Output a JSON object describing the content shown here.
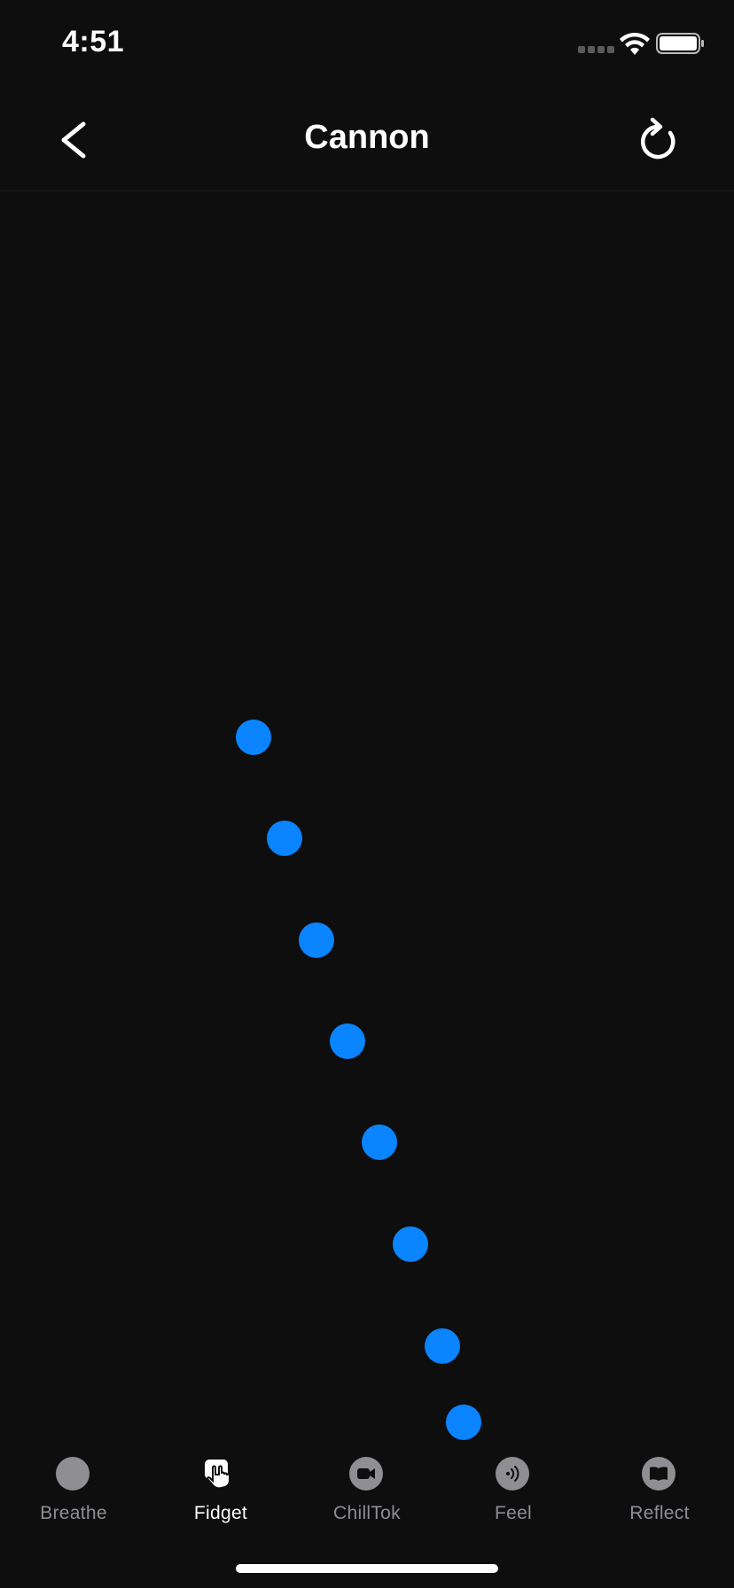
{
  "status_bar": {
    "time": "4:51"
  },
  "header": {
    "title": "Cannon",
    "back_icon": "chevron-left-icon",
    "reload_icon": "reload-icon"
  },
  "colors": {
    "background": "#0e0e0f",
    "ball": "#0a84ff",
    "tab_inactive": "#8e8e93",
    "tab_active": "#ffffff"
  },
  "tabs": [
    {
      "label": "Breathe",
      "icon": "circle-icon",
      "active": false
    },
    {
      "label": "Fidget",
      "icon": "hand-tap-icon",
      "active": true
    },
    {
      "label": "ChillTok",
      "icon": "video-camera-icon",
      "active": false
    },
    {
      "label": "Feel",
      "icon": "sound-waves-icon",
      "active": false
    },
    {
      "label": "Reflect",
      "icon": "book-icon",
      "active": false
    }
  ]
}
